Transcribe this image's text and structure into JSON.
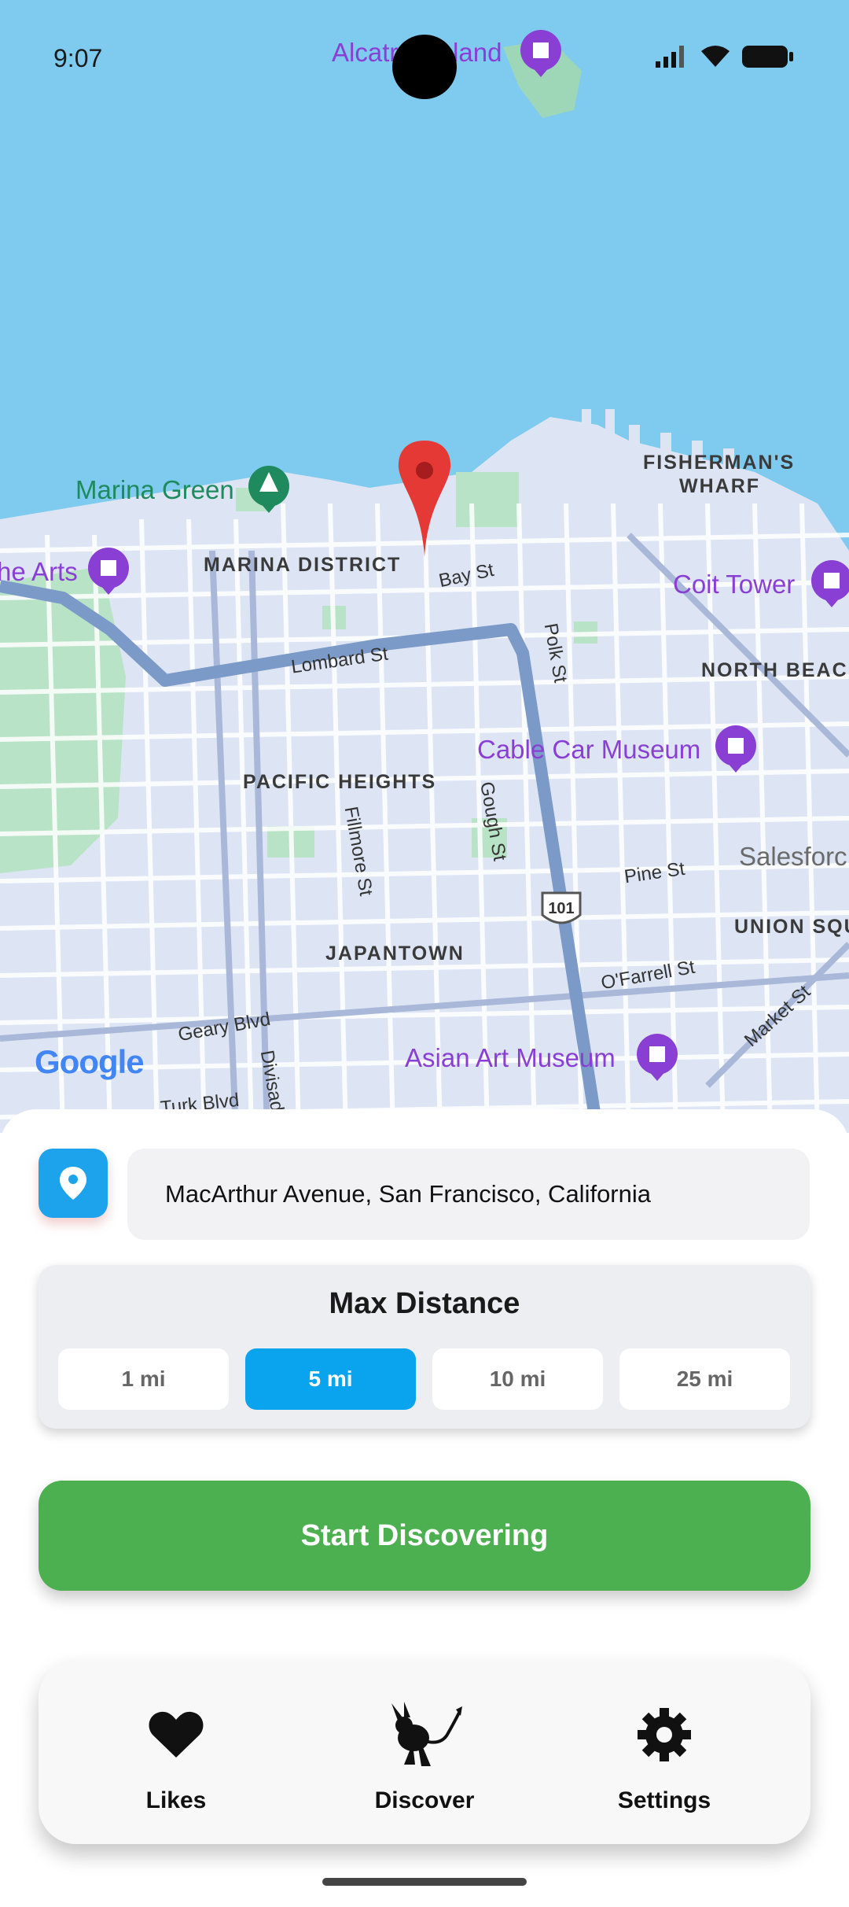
{
  "status_bar": {
    "time": "9:07"
  },
  "map": {
    "pois": [
      {
        "id": "alcatraz",
        "label": "Alcatraz Island",
        "color": "#8a3fd4"
      },
      {
        "id": "marina-green",
        "label": "Marina Green",
        "color": "#1e8a5e"
      },
      {
        "id": "arts",
        "label": "he Arts",
        "color": "#8a3fd4"
      },
      {
        "id": "coit",
        "label": "Coit Tower",
        "color": "#8a3fd4"
      },
      {
        "id": "cable-car",
        "label": "Cable Car Museum",
        "color": "#8a3fd4"
      },
      {
        "id": "asian-art",
        "label": "Asian Art Museum",
        "color": "#8a3fd4"
      },
      {
        "id": "salesforce",
        "label": "Salesforc",
        "color": "#6a6a6a"
      }
    ],
    "districts": [
      "FISHERMAN'S",
      "WHARF",
      "MARINA DISTRICT",
      "NORTH BEACH",
      "PACIFIC HEIGHTS",
      "JAPANTOWN",
      "UNION SQU"
    ],
    "streets": [
      "Bay St",
      "Lombard St",
      "Polk St",
      "Gough St",
      "Fillmore St",
      "Pine St",
      "O'Farrell St",
      "Geary Blvd",
      "Divisad",
      "Turk Blvd",
      "Market St"
    ],
    "highway_shield": "101",
    "attribution": "Google"
  },
  "location": {
    "address": "MacArthur Avenue, San Francisco, California"
  },
  "distance": {
    "title": "Max Distance",
    "options": [
      "1 mi",
      "5 mi",
      "10 mi",
      "25 mi"
    ],
    "selected": "5 mi"
  },
  "start_button": {
    "label": "Start Discovering"
  },
  "nav": {
    "items": [
      {
        "label": "Likes",
        "icon": "heart-icon"
      },
      {
        "label": "Discover",
        "icon": "jerboa-icon"
      },
      {
        "label": "Settings",
        "icon": "gear-icon"
      }
    ]
  },
  "colors": {
    "accent": "#0aa4ee",
    "primary_button": "#4caf50",
    "water": "#7ecbef",
    "pin": "#e53935"
  }
}
